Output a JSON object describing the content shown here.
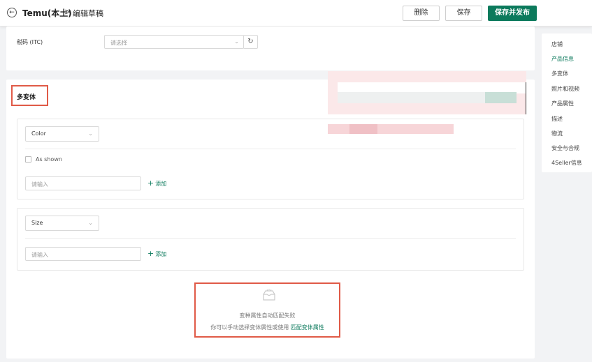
{
  "header": {
    "title": "Temu(本土)",
    "separator": ">",
    "subtitle": "编辑草稿",
    "back_icon": "arrow-left-icon",
    "delete_label": "删除",
    "save_label": "保存",
    "publish_label": "保存并发布"
  },
  "itc": {
    "label": "税码 (ITC)",
    "placeholder": "请选择",
    "refresh_icon": "refresh-icon"
  },
  "variant": {
    "title": "多变体",
    "color_attr": {
      "selected": "Color",
      "checkbox_label": "As shown",
      "input_placeholder": "请输入",
      "add_label": "添加"
    },
    "size_attr": {
      "selected": "Size",
      "input_placeholder": "请输入",
      "add_label": "添加"
    },
    "empty": {
      "icon": "empty-inbox-icon",
      "title": "变种属性自动匹配失败",
      "desc": "你可以手动选择变体属性或使用",
      "link": "匹配变体属性"
    }
  },
  "side_nav": {
    "items": [
      {
        "label": "店铺",
        "active": false
      },
      {
        "label": "产品信息",
        "active": true
      },
      {
        "label": "多变体",
        "active": false
      },
      {
        "label": "照片和视频",
        "active": false
      },
      {
        "label": "产品属性",
        "active": false
      },
      {
        "label": "描述",
        "active": false
      },
      {
        "label": "物流",
        "active": false
      },
      {
        "label": "安全与合规",
        "active": false
      },
      {
        "label": "4Seller信息",
        "active": false
      }
    ]
  },
  "colors": {
    "brand": "#0c7a5c",
    "highlight": "#e05a47"
  }
}
